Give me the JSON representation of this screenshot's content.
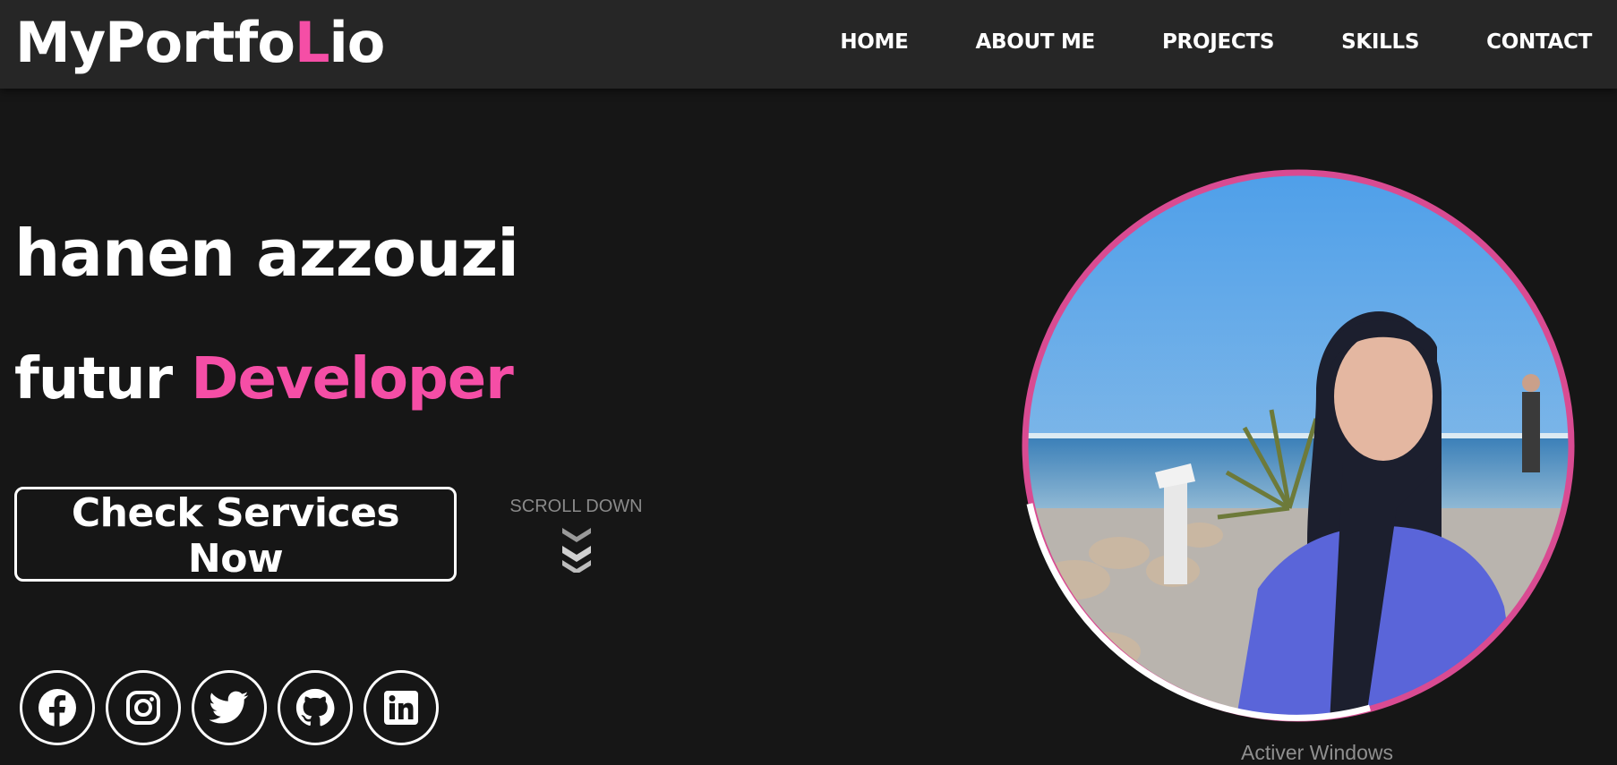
{
  "header": {
    "logo_part1": "MyPortfo",
    "logo_part2": "L",
    "logo_part3": "io",
    "nav": [
      "HOME",
      "ABOUT ME",
      "PROJECTS",
      "SKILLS",
      "CONTACT"
    ]
  },
  "hero": {
    "name": "hanen azzouzi",
    "role_prefix": "futur",
    "role_highlight": "Developer",
    "cta_label": "Check Services Now",
    "scroll_label": "SCROLL DOWN"
  },
  "socials": [
    "facebook-icon",
    "instagram-icon",
    "twitter-icon",
    "github-icon",
    "linkedin-icon"
  ],
  "overlay": {
    "watermark": "Activer Windows"
  },
  "colors": {
    "accent": "#f54ea6",
    "background": "#161616",
    "navbar": "#262626"
  }
}
